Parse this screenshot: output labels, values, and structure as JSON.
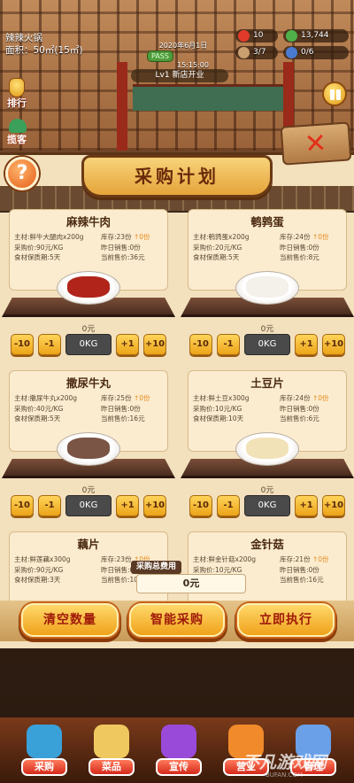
{
  "store": {
    "name": "辣辣火锅",
    "area_label": "面积：50㎡(15㎡)"
  },
  "clock": {
    "date": "2020年6月1日",
    "time": "15:15:00",
    "pass_badge": "PASS"
  },
  "level": {
    "text": "Lv1 新店开业"
  },
  "resources": [
    {
      "name": "tomato-icon",
      "value": "10",
      "color": "#e23a2a"
    },
    {
      "name": "money-icon",
      "value": "13,744",
      "color": "#4fb04a"
    },
    {
      "name": "chef-icon",
      "value": "3/7",
      "color": "#caa070"
    },
    {
      "name": "staff-icon",
      "value": "0/6",
      "color": "#4a7ad0"
    }
  ],
  "side": {
    "rank_label": "排行",
    "rank2_label": "揽客"
  },
  "panel": {
    "title": "采购计划",
    "help_glyph": "?",
    "close_glyph": "✕"
  },
  "items": [
    {
      "name": "麻辣牛肉",
      "material": "主材:鲜牛大腿肉x200g",
      "cost": "采购价:90元/KG",
      "shelf_life": "食材保质期:5天",
      "stock": "库存:23份",
      "stock_up": "↑0份",
      "sold": "昨日销售:0份",
      "price": "当前售价:36元",
      "amount": "0元",
      "qty": "0KG",
      "food_color": "#b0241a"
    },
    {
      "name": "鹌鹑蛋",
      "material": "主材:鹌鹑蛋x200g",
      "cost": "采购价:20元/KG",
      "shelf_life": "食材保质期:5天",
      "stock": "库存:24份",
      "stock_up": "↑0份",
      "sold": "昨日销售:0份",
      "price": "当前售价:8元",
      "amount": "0元",
      "qty": "0KG",
      "food_color": "#f4f0ea"
    },
    {
      "name": "撒尿牛丸",
      "material": "主材:撒尿牛丸x200g",
      "cost": "采购价:40元/KG",
      "shelf_life": "食材保质期:5天",
      "stock": "库存:25份",
      "stock_up": "↑0份",
      "sold": "昨日销售:0份",
      "price": "当前售价:16元",
      "amount": "0元",
      "qty": "0KG",
      "food_color": "#7a5444"
    },
    {
      "name": "土豆片",
      "material": "主材:鲜土豆x300g",
      "cost": "采购价:10元/KG",
      "shelf_life": "食材保质期:10天",
      "stock": "库存:24份",
      "stock_up": "↑0份",
      "sold": "昨日销售:0份",
      "price": "当前售价:6元",
      "amount": "0元",
      "qty": "0KG",
      "food_color": "#f2e2b8"
    },
    {
      "name": "藕片",
      "material": "主材:鲜莲藕x300g",
      "cost": "采购价:90元/KG",
      "shelf_life": "食材保质期:3天",
      "stock": "库存:23份",
      "stock_up": "↑0份",
      "sold": "昨日销售:0份",
      "price": "当前售价:10元",
      "amount": "",
      "qty": "",
      "food_color": "#e8dcc0"
    },
    {
      "name": "金针菇",
      "material": "主材:鲜金针菇x200g",
      "cost": "采购价:10元/KG",
      "shelf_life": "食材保质期:5天",
      "stock": "库存:21份",
      "stock_up": "↑0份",
      "sold": "昨日销售:0份",
      "price": "当前售价:16元",
      "amount": "",
      "qty": "",
      "food_color": "#f4ecd0"
    }
  ],
  "qty_buttons": {
    "minus10": "-10",
    "minus1": "-1",
    "plus1": "+1",
    "plus10": "+10"
  },
  "total": {
    "label": "采购总费用",
    "value": "0元"
  },
  "actions": {
    "clear": "清空数量",
    "smart": "智能采购",
    "execute": "立即执行"
  },
  "nav": [
    {
      "label": "采购",
      "icon": "shop-icon",
      "color": "#3aa0d8"
    },
    {
      "label": "菜品",
      "icon": "dish-icon",
      "color": "#f0c860"
    },
    {
      "label": "宣传",
      "icon": "megaphone-icon",
      "color": "#9a4ad8"
    },
    {
      "label": "营业",
      "icon": "chef-hat-icon",
      "color": "#f08a2a"
    },
    {
      "label": "管理",
      "icon": "manage-icon",
      "color": "#6aa0e8"
    }
  ],
  "watermark": {
    "text": "不凡游戏网",
    "sub": "BUFAN.COM"
  }
}
